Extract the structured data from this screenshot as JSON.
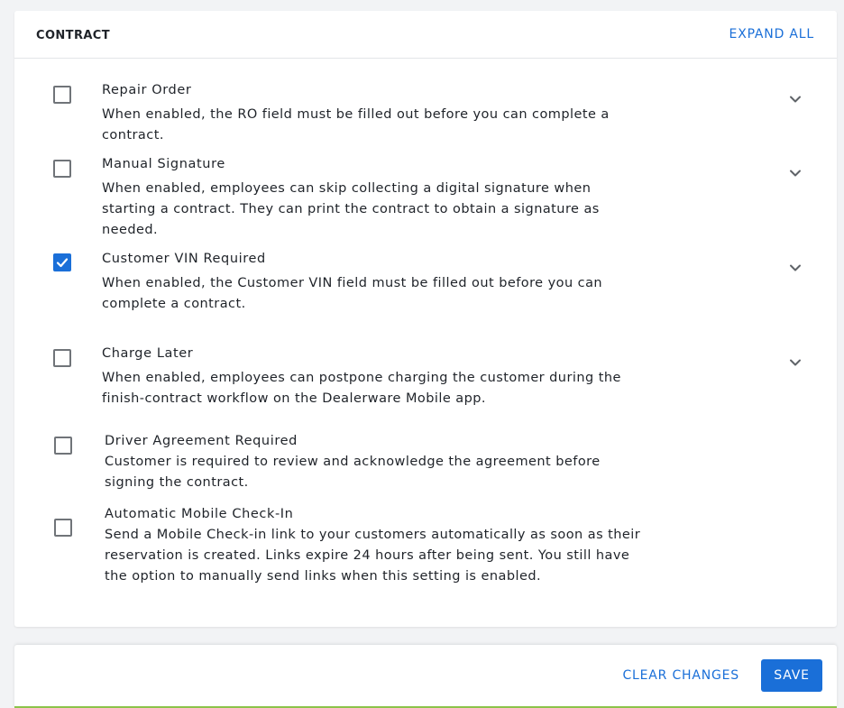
{
  "header": {
    "title": "CONTRACT",
    "expand_all_label": "EXPAND ALL"
  },
  "settings": [
    {
      "title": "Repair Order",
      "description": "When enabled, the RO field must be filled out before you can complete a contract.",
      "checked": false,
      "expandable": true
    },
    {
      "title": "Manual Signature",
      "description": "When enabled, employees can skip collecting a digital signature when starting a contract. They can print the contract to obtain a signature as needed.",
      "checked": false,
      "expandable": true
    },
    {
      "title": "Customer VIN Required",
      "description": "When enabled, the Customer VIN field must be filled out before you can complete a contract.",
      "checked": true,
      "expandable": true
    },
    {
      "title": "Charge Later",
      "description": "When enabled, employees can postpone charging the customer during the finish-contract workflow on the Dealerware Mobile app.",
      "checked": false,
      "expandable": true
    },
    {
      "title": "Driver Agreement Required",
      "description": "Customer is required to review and acknowledge the agreement before signing the contract.",
      "checked": false,
      "expandable": false
    },
    {
      "title": "Automatic Mobile Check-In",
      "description": "Send a Mobile Check-in link to your customers automatically as soon as their reservation is created. Links expire 24 hours after being sent. You still have the option to manually send links when this setting is enabled.",
      "checked": false,
      "expandable": false
    }
  ],
  "footer": {
    "clear_label": "CLEAR CHANGES",
    "save_label": "SAVE"
  },
  "colors": {
    "accent": "#1a6fd8",
    "footer_border": "#8bc34a"
  }
}
